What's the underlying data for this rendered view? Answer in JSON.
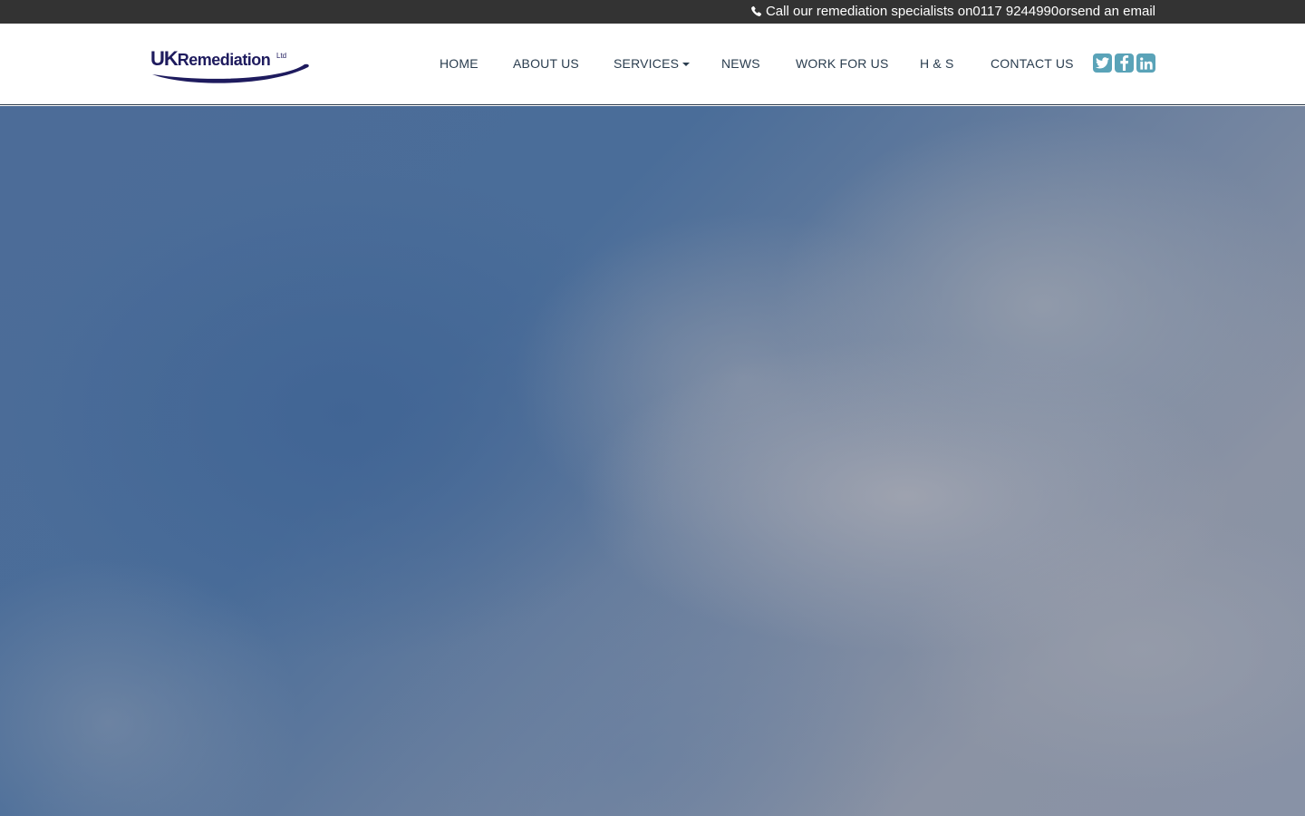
{
  "topbar": {
    "icon": "phone-icon",
    "text_prefix": "Call our remediation specialists on ",
    "phone": "0117 9244990",
    "text_mid": " or ",
    "email_link": "send an email"
  },
  "logo": {
    "uk": "UK",
    "name": "Remediation",
    "ltd": "Ltd",
    "color": "#1e1b5e"
  },
  "nav": {
    "items": [
      {
        "label": "HOME"
      },
      {
        "label": "ABOUT US"
      },
      {
        "label": "SERVICES"
      },
      {
        "label": "NEWS"
      },
      {
        "label": "WORK FOR US"
      },
      {
        "label": "H & S"
      },
      {
        "label": "CONTACT US"
      }
    ],
    "social": [
      {
        "icon": "twitter-icon"
      },
      {
        "icon": "facebook-icon"
      },
      {
        "icon": "linkedin-icon"
      }
    ],
    "social_color": "#5aa3b8"
  },
  "hero": {
    "description_colors": [
      "#4a6d99",
      "#8b93a4"
    ]
  }
}
